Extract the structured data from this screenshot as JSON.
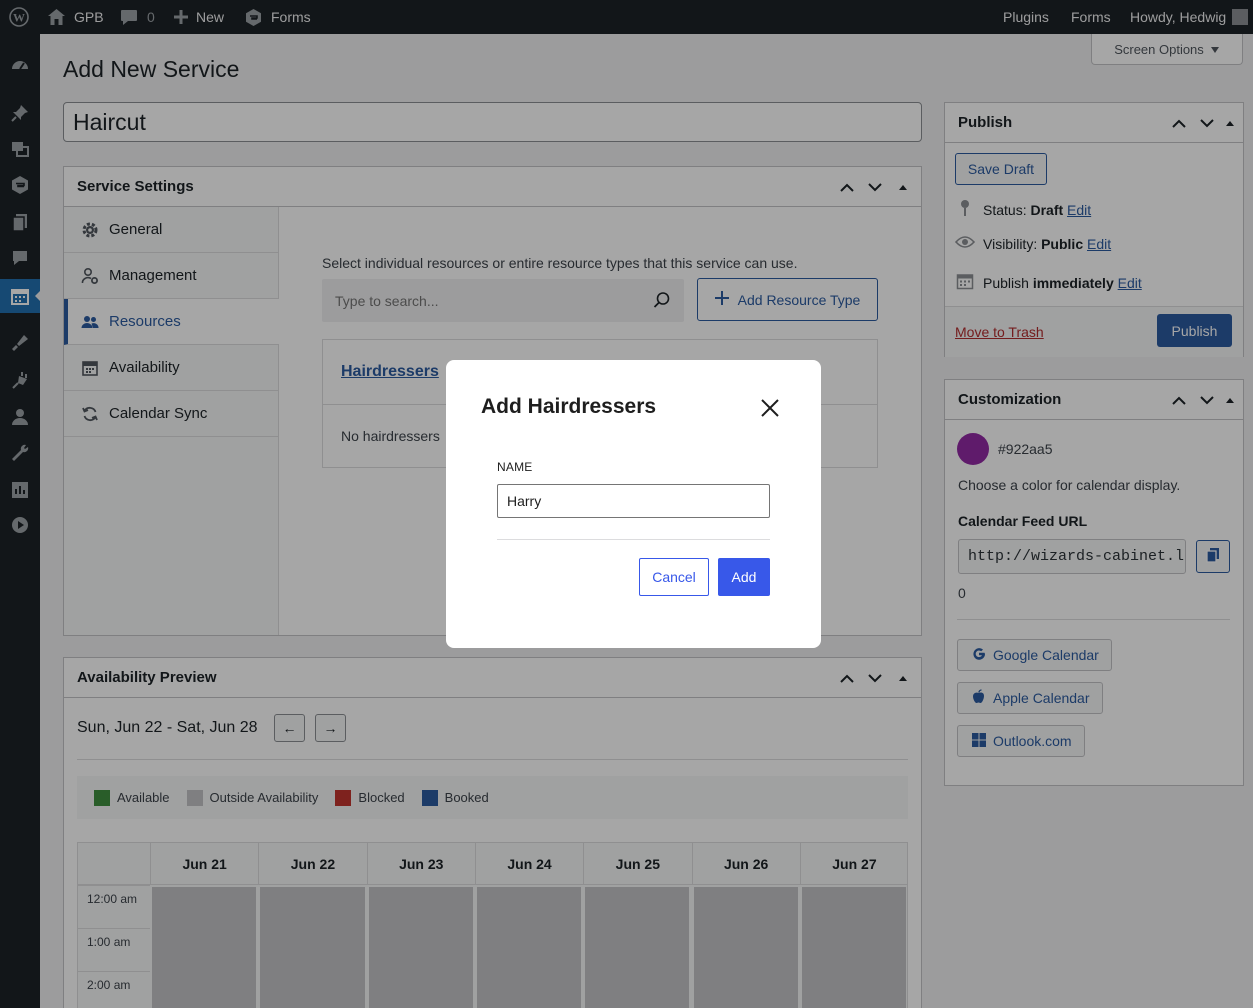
{
  "adminbar": {
    "site_name": "GPB",
    "comments_count": "0",
    "new_label": "New",
    "forms_label": "Forms",
    "plugins_label": "Plugins",
    "forms_right_label": "Forms",
    "howdy": "Howdy, Hedwig"
  },
  "sidemenu": {
    "icons": [
      "dashboard-icon",
      "pin-icon",
      "media-icon",
      "gravity-forms-icon",
      "pages-icon",
      "comments-icon",
      "calendar-icon",
      "appearance-icon",
      "plugins-icon",
      "users-icon",
      "tools-icon",
      "settings-icon",
      "media-play-icon"
    ]
  },
  "page": {
    "title": "Add New Service",
    "screen_options": "Screen Options",
    "post_title": "Haircut"
  },
  "service_settings": {
    "title": "Service Settings",
    "tabs": [
      {
        "label": "General",
        "icon": "gear-icon"
      },
      {
        "label": "Management",
        "icon": "user-gear-icon"
      },
      {
        "label": "Resources",
        "icon": "users-icon"
      },
      {
        "label": "Availability",
        "icon": "calendar-icon"
      },
      {
        "label": "Calendar Sync",
        "icon": "sync-icon"
      }
    ],
    "active_tab": "Resources",
    "resources": {
      "description": "Select individual resources or entire resource types that this service can use.",
      "search_placeholder": "Type to search...",
      "add_resource_type": "Add Resource Type",
      "group_title": "Hairdressers",
      "empty_text": "No hairdressers"
    }
  },
  "availability_preview": {
    "title": "Availability Preview",
    "date_range": "Sun, Jun 22 - Sat, Jun 28",
    "prev": "←",
    "next": "→",
    "legend": [
      {
        "label": "Available",
        "color": "#3f8f3f"
      },
      {
        "label": "Outside Availability",
        "color": "#c3c4c7"
      },
      {
        "label": "Blocked",
        "color": "#c2352e"
      },
      {
        "label": "Booked",
        "color": "#2c5ba0"
      }
    ],
    "days": [
      "Jun 21",
      "Jun 22",
      "Jun 23",
      "Jun 24",
      "Jun 25",
      "Jun 26",
      "Jun 27"
    ],
    "times": [
      "12:00 am",
      "1:00 am",
      "2:00 am"
    ]
  },
  "publish": {
    "title": "Publish",
    "save_draft": "Save Draft",
    "status_label": "Status:",
    "status_value": "Draft",
    "visibility_label": "Visibility:",
    "visibility_value": "Public",
    "publish_label": "Publish",
    "publish_value": "immediately",
    "edit": "Edit",
    "move_to_trash": "Move to Trash",
    "publish_button": "Publish"
  },
  "customization": {
    "title": "Customization",
    "color": "#922aa5",
    "color_label": "#922aa5",
    "color_help": "Choose a color for calendar display.",
    "feed_label": "Calendar Feed URL",
    "feed_url": "http://wizards-cabinet.lo",
    "feed_count": "0",
    "google": "Google Calendar",
    "apple": "Apple Calendar",
    "outlook": "Outlook.com"
  },
  "modal": {
    "title": "Add Hairdressers",
    "name_label": "NAME",
    "name_value": "Harry",
    "cancel": "Cancel",
    "add": "Add",
    "accent": "#3858e9"
  }
}
